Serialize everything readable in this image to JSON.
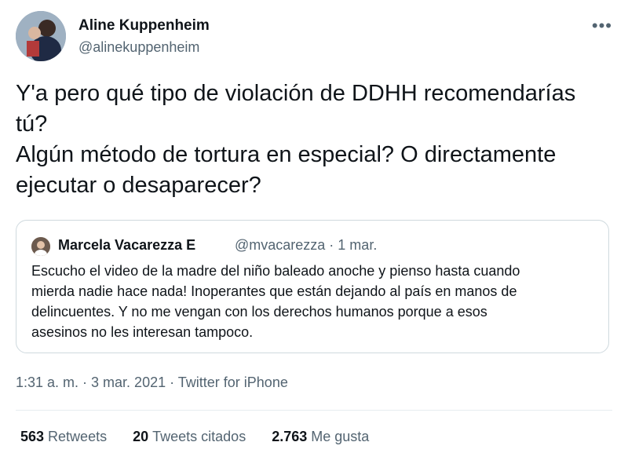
{
  "author": {
    "name": "Aline Kuppenheim",
    "handle": "@alinekuppenheim"
  },
  "more_icon": "more-horizontal-icon",
  "tweet": {
    "lines": [
      "Y'a pero qué tipo de violación de DDHH recomendarías",
      "tú?",
      "Algún método de tortura en especial? O directamente",
      "ejecutar o desaparecer?"
    ]
  },
  "quoted": {
    "name": "Marcela Vacarezza E",
    "handle_date": "@mvacarezza · 1 mar.",
    "lines": [
      "Escucho el video de la madre del niño baleado anoche y pienso hasta cuando",
      "mierda nadie hace nada! Inoperantes que están dejando al país en manos de",
      "delincuentes. Y no me vengan con los derechos humanos porque a esos",
      "asesinos no les interesan tampoco."
    ]
  },
  "meta": {
    "time_date": "1:31 a. m. · 3 mar. 2021 · ",
    "source": "Twitter for iPhone"
  },
  "stats": {
    "retweets_count": "563",
    "retweets_label": "Retweets",
    "quotes_count": "20",
    "quotes_label": "Tweets citados",
    "likes_count": "2.763",
    "likes_label": "Me gusta"
  },
  "colors": {
    "primary_text": "#0f1419",
    "secondary_text": "#536471",
    "border": "#cfd9de"
  }
}
